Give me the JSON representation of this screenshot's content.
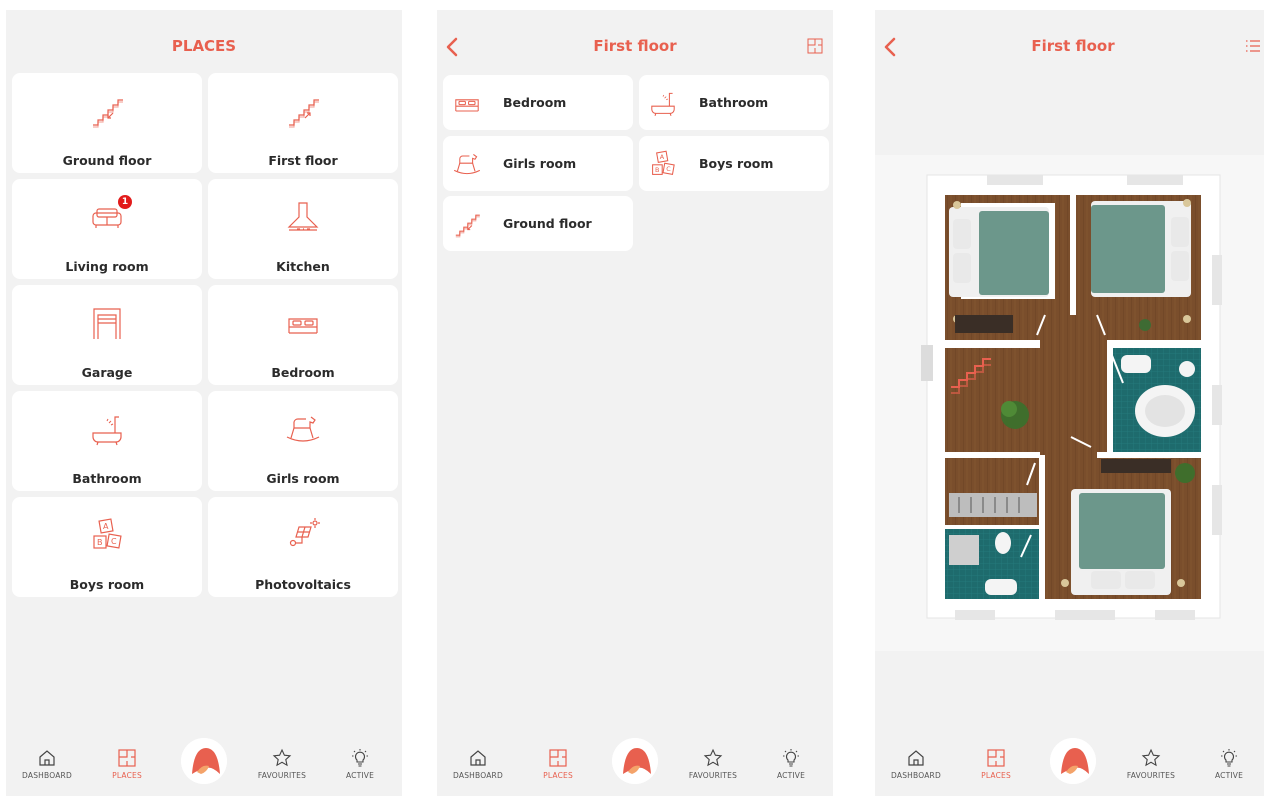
{
  "colors": {
    "accent": "#e8604f",
    "screen_bg": "#f2f2f2",
    "text": "#2b2b2b",
    "badge": "#e21b1b"
  },
  "screen1": {
    "title": "PLACES",
    "tiles": [
      {
        "label": "Ground floor",
        "icon": "stairs-down-icon"
      },
      {
        "label": "First floor",
        "icon": "stairs-up-icon"
      },
      {
        "label": "Living room",
        "icon": "sofa-icon",
        "badge": "1"
      },
      {
        "label": "Kitchen",
        "icon": "range-hood-icon"
      },
      {
        "label": "Garage",
        "icon": "garage-icon"
      },
      {
        "label": "Bedroom",
        "icon": "bed-icon"
      },
      {
        "label": "Bathroom",
        "icon": "bathtub-icon"
      },
      {
        "label": "Girls room",
        "icon": "rocking-horse-icon"
      },
      {
        "label": "Boys room",
        "icon": "abc-blocks-icon"
      },
      {
        "label": "Photovoltaics",
        "icon": "solar-panel-icon"
      }
    ]
  },
  "screen2": {
    "title": "First floor",
    "rooms": [
      {
        "label": "Bedroom",
        "icon": "bed-icon"
      },
      {
        "label": "Bathroom",
        "icon": "bathtub-icon"
      },
      {
        "label": "Girls room",
        "icon": "rocking-horse-icon"
      },
      {
        "label": "Boys room",
        "icon": "abc-blocks-icon"
      },
      {
        "label": "Ground floor",
        "icon": "stairs-down-icon"
      }
    ]
  },
  "screen3": {
    "title": "First floor"
  },
  "nav": {
    "items": [
      {
        "label": "DASHBOARD",
        "icon": "home-icon"
      },
      {
        "label": "PLACES",
        "icon": "floorplan-icon",
        "active": true
      },
      {
        "label": "FAVOURITES",
        "icon": "star-icon"
      },
      {
        "label": "ACTIVE",
        "icon": "bulb-icon"
      }
    ]
  }
}
